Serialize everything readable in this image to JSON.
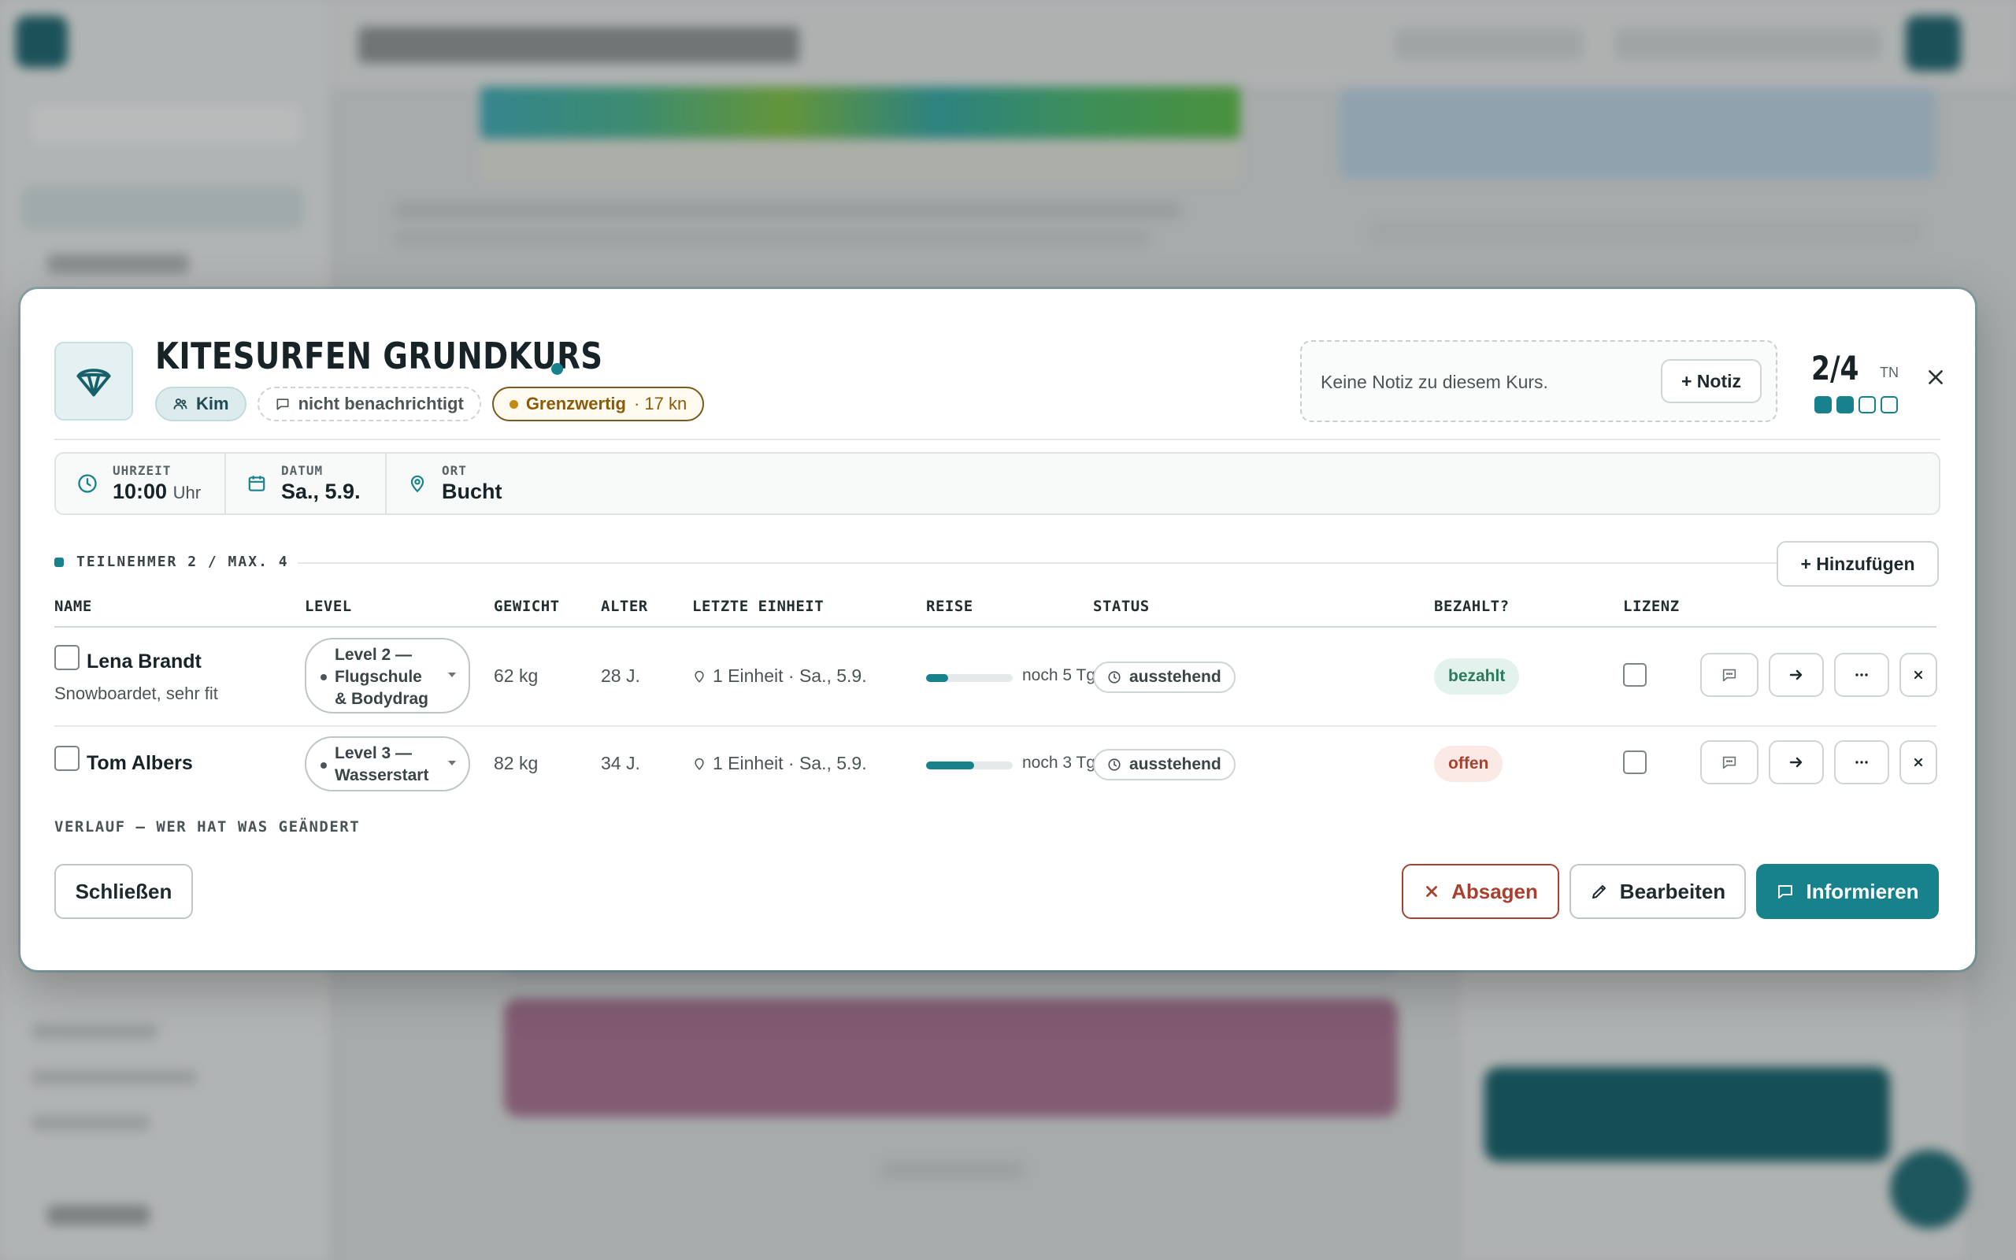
{
  "colors": {
    "accent": "#17818c",
    "warning_border": "#7a5a1c",
    "danger": "#a8402f",
    "paid_bg": "#e3f2ec",
    "open_bg": "#fbe9e6"
  },
  "course": {
    "icon": "paraglider-icon",
    "title": "KITESURFEN GRUNDKURS",
    "chips": {
      "instructor": "Kim",
      "notify": "nicht benachrichtigt",
      "wind_label": "Grenzwertig",
      "wind_value": "· 17 kn"
    },
    "note": {
      "text": "Keine Notiz zu diesem Kurs.",
      "button": "+ Notiz"
    },
    "capacity": {
      "count": "2/4",
      "unit": "TN",
      "filled": 2,
      "total": 4
    }
  },
  "info": {
    "time_label": "UHRZEIT",
    "time_value": "10:00",
    "time_unit": "Uhr",
    "date_label": "DATUM",
    "date_value": "Sa., 5.9.",
    "place_label": "ORT",
    "place_value": "Bucht"
  },
  "participants": {
    "section_title": "TEILNEHMER 2 / MAX. 4",
    "add_button": "+ Hinzufügen",
    "columns": [
      "NAME",
      "LEVEL",
      "GEWICHT",
      "ALTER",
      "LETZTE EINHEIT",
      "REISE",
      "STATUS",
      "BEZAHLT?",
      "LIZENZ"
    ],
    "rows": [
      {
        "name": "Lena Brandt",
        "note": "Snowboardet, sehr fit",
        "level_line1": "Level 2 —",
        "level_line2": "Flugschule",
        "level_line3": "& Bodydrag",
        "weight": "62 kg",
        "age": "28 J.",
        "last_unit": "1 Einheit · Sa., 5.9.",
        "trip_progress": 0.25,
        "trip_text": "noch 5 Tg.",
        "status": "ausstehend",
        "paid": "bezahlt"
      },
      {
        "name": "Tom Albers",
        "note": "",
        "level_line1": "Level 3 —",
        "level_line2": "Wasserstart",
        "level_line3": "",
        "weight": "82 kg",
        "age": "34 J.",
        "last_unit": "1 Einheit · Sa., 5.9.",
        "trip_progress": 0.55,
        "trip_text": "noch 3 Tg.",
        "status": "ausstehend",
        "paid": "offen"
      }
    ]
  },
  "history_title": "VERLAUF — WER HAT WAS GEÄNDERT",
  "footer": {
    "close": "Schließen",
    "cancel": "Absagen",
    "edit": "Bearbeiten",
    "inform": "Informieren"
  }
}
